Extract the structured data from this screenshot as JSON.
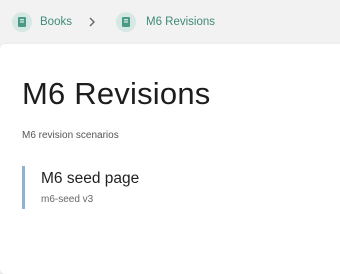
{
  "breadcrumb": {
    "items": [
      {
        "label": "Books",
        "icon": "book-icon"
      },
      {
        "label": "M6 Revisions",
        "icon": "book-icon"
      }
    ],
    "separator_icon": "chevron-right-icon"
  },
  "page": {
    "title": "M6 Revisions",
    "description": "M6 revision scenarios"
  },
  "entries": [
    {
      "title": "M6 seed page",
      "subtitle": "m6-seed v3"
    }
  ],
  "colors": {
    "accent": "#3f8a78",
    "icon_bg": "#d6e8e3",
    "entry_border": "#8fb2d9",
    "background": "#f2f2f2"
  }
}
